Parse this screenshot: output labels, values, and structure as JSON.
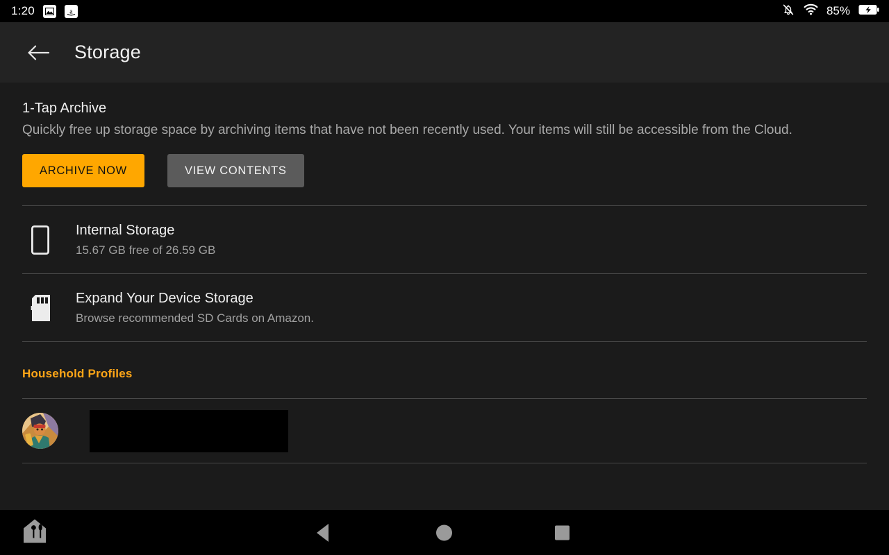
{
  "status_bar": {
    "clock": "1:20",
    "battery_percent": "85%",
    "icons": [
      "photos-icon",
      "amazon-app-icon",
      "notifications-muted-icon",
      "wifi-icon",
      "battery-charging-icon"
    ]
  },
  "app_bar": {
    "back_icon": "back-arrow-icon",
    "title": "Storage"
  },
  "archive": {
    "title": "1-Tap Archive",
    "description": "Quickly free up storage space by archiving items that have not been recently used. Your items will still be accessible from the Cloud.",
    "primary_button": "ARCHIVE NOW",
    "secondary_button": "VIEW CONTENTS"
  },
  "rows": [
    {
      "icon": "tablet-device-icon",
      "title": "Internal Storage",
      "subtitle": "15.67 GB free of 26.59 GB"
    },
    {
      "icon": "sd-card-icon",
      "title": "Expand Your Device Storage",
      "subtitle": "Browse recommended SD Cards on Amazon."
    }
  ],
  "household": {
    "section_title": "Household Profiles",
    "profiles": [
      {
        "avatar": "profile-avatar-image",
        "name": "",
        "name_redacted": true
      }
    ]
  },
  "nav_bar": {
    "items": [
      {
        "icon": "household-home-icon",
        "label": "Home"
      },
      {
        "icon": "back-triangle-icon",
        "label": "Back"
      },
      {
        "icon": "home-circle-icon",
        "label": "Home"
      },
      {
        "icon": "recents-square-icon",
        "label": "Recents"
      }
    ]
  },
  "colors": {
    "accent_orange": "#ffa700",
    "section_heading_orange": "#ffa617",
    "background": "#1b1b1b",
    "app_bar": "#232323",
    "secondary_button": "#5b5b5b"
  }
}
